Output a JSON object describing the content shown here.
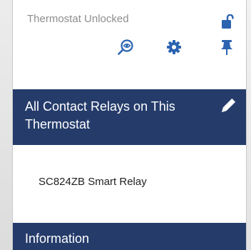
{
  "status": {
    "text": "Thermostat Unlocked",
    "lock_icon": "lock-open-icon"
  },
  "toolbar": {
    "icons": [
      "search-icon",
      "gear-icon",
      "pin-icon"
    ],
    "accent_color": "#2a63b0"
  },
  "relays_section": {
    "title": "All Contact Relays on This Thermostat",
    "edit_icon": "pencil-icon",
    "items": [
      {
        "label": "SC824ZB Smart Relay"
      }
    ]
  },
  "info_section": {
    "title": "Information"
  },
  "colors": {
    "header_bg": "#253c6b",
    "status_text": "#8e8e8e",
    "accent": "#2a63b0"
  }
}
